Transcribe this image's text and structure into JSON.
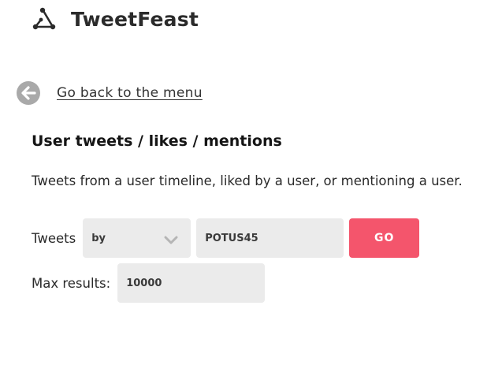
{
  "header": {
    "logo_icon": "triangle-nodes-icon",
    "title": "TweetFeast"
  },
  "nav": {
    "back_icon": "arrow-left-circle-icon",
    "back_label": "Go back to the menu"
  },
  "main": {
    "section_title": "User tweets / likes / mentions",
    "description": "Tweets from a user timeline, liked by a user, or mentioning a user."
  },
  "form": {
    "tweets_label": "Tweets",
    "mode_select": {
      "selected": "by",
      "icon": "chevron-down-icon"
    },
    "username_value": "POTUS45",
    "go_label": "GO",
    "max_results_label": "Max results:",
    "max_results_value": "10000"
  },
  "colors": {
    "accent": "#f4556c",
    "input_bg": "#ebebeb",
    "back_icon": "#a9a9a9",
    "text": "#1f1f1f"
  }
}
